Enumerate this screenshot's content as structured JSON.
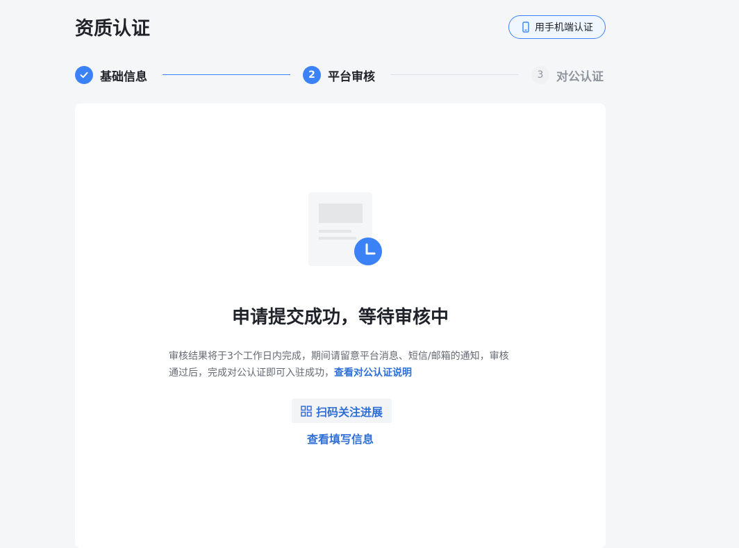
{
  "header": {
    "title": "资质认证",
    "mobile_button_label": "用手机端认证"
  },
  "steps": [
    {
      "number": "1",
      "label": "基础信息",
      "status": "done"
    },
    {
      "number": "2",
      "label": "平台审核",
      "status": "active"
    },
    {
      "number": "3",
      "label": "对公认证",
      "status": "pending"
    }
  ],
  "main": {
    "status_title": "申请提交成功，等待审核中",
    "description": "审核结果将于3个工作日内完成，期间请留意平台消息、短信/邮箱的通知，审核通过后，完成对公认证即可入驻成功，",
    "description_link": "查看对公认证说明",
    "scan_button_label": "扫码关注进展",
    "view_info_link": "查看填写信息"
  },
  "colors": {
    "accent": "#3b82f6",
    "link": "#2f6fd6",
    "page_bg": "#f5f6f7",
    "card_bg": "#ffffff"
  },
  "icons": {
    "mobile": "phone-icon",
    "step_done": "check-icon",
    "scan": "qrcode-icon",
    "illustration": "document-clock-icon"
  }
}
